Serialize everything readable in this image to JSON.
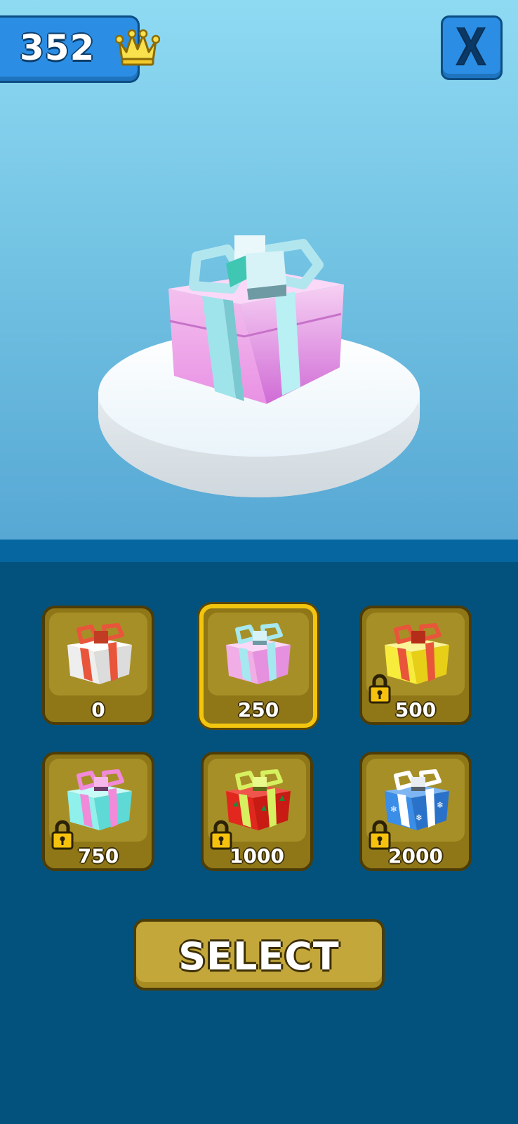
{
  "hud": {
    "coins": "352",
    "currency_icon": "crown-icon",
    "close_icon": "close-icon"
  },
  "preview": {
    "gift_icon": "gift-icon",
    "box_color": "#f1aee6",
    "ribbon_color": "#a6e8ef"
  },
  "shop": {
    "items": [
      {
        "price": "0",
        "locked": false,
        "selected": false,
        "box": "#f6f6f6",
        "ribbon": "#e8553b"
      },
      {
        "price": "250",
        "locked": false,
        "selected": true,
        "box": "#f1aee6",
        "ribbon": "#a6e8ef"
      },
      {
        "price": "500",
        "locked": true,
        "selected": false,
        "box": "#f7ec3c",
        "ribbon": "#e8553b"
      },
      {
        "price": "750",
        "locked": true,
        "selected": false,
        "box": "#8ff0ec",
        "ribbon": "#f08ad9"
      },
      {
        "price": "1000",
        "locked": true,
        "selected": false,
        "box": "#e2271f",
        "ribbon": "#d6f060"
      },
      {
        "price": "2000",
        "locked": true,
        "selected": false,
        "box": "#3b8ee8",
        "ribbon": "#ffffff"
      }
    ],
    "lock_icon": "lock-icon"
  },
  "actions": {
    "select_label": "SELECT"
  }
}
